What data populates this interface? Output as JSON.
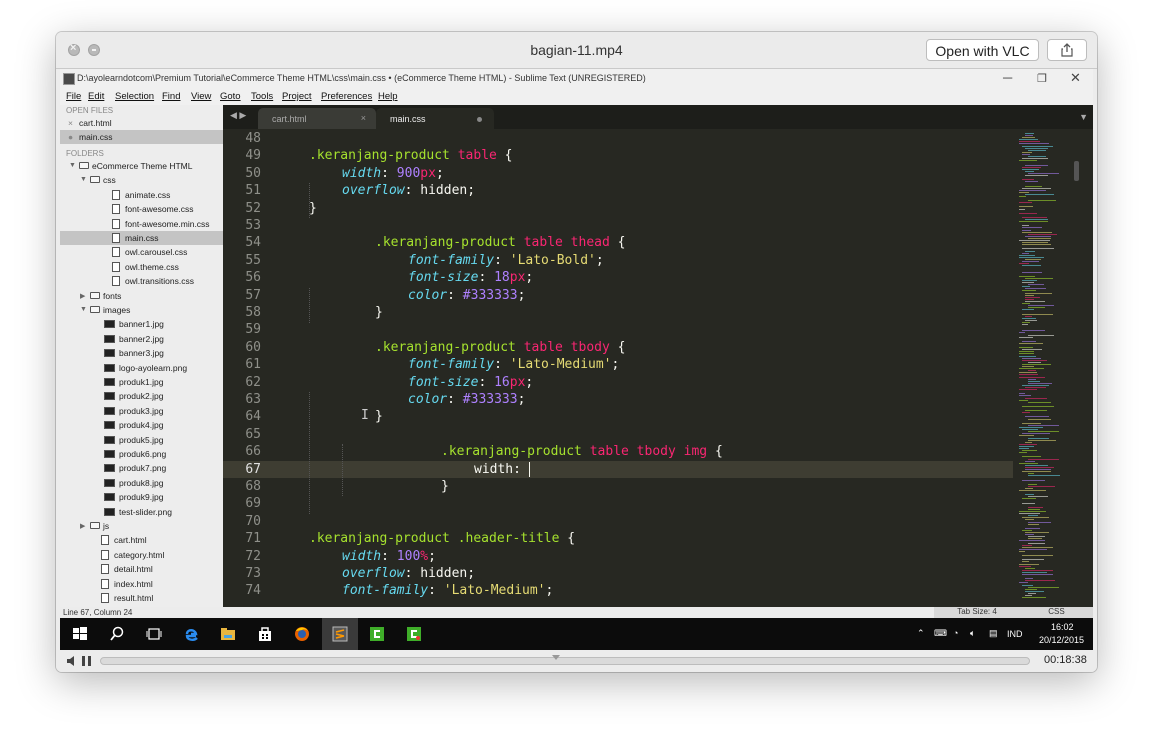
{
  "qt": {
    "title": "bagian-11.mp4",
    "open_vlc_label": "Open with VLC",
    "time": "00:18:38",
    "progress_fraction": 0.49
  },
  "sublime": {
    "title": "D:\\ayolearndotcom\\Premium Tutorial\\eCommerce Theme HTML\\css\\main.css • (eCommerce Theme HTML) - Sublime Text (UNREGISTERED)",
    "win_min": "─",
    "win_max": "❐",
    "win_close": "✕",
    "menu": [
      "File",
      "Edit",
      "Selection",
      "Find",
      "View",
      "Goto",
      "Tools",
      "Project",
      "Preferences",
      "Help"
    ],
    "sidebar": {
      "open_files_header": "OPEN FILES",
      "open_files": [
        {
          "name": "cart.html",
          "prefix": "×",
          "selected": false
        },
        {
          "name": "main.css",
          "prefix": "●",
          "selected": true
        }
      ],
      "folders_header": "FOLDERS",
      "tree": [
        {
          "name": "eCommerce Theme HTML",
          "kind": "folder-open",
          "depth": 0
        },
        {
          "name": "css",
          "kind": "folder-open",
          "depth": 1
        },
        {
          "name": "animate.css",
          "kind": "file",
          "depth": 2
        },
        {
          "name": "font-awesome.css",
          "kind": "file",
          "depth": 2
        },
        {
          "name": "font-awesome.min.css",
          "kind": "file",
          "depth": 2
        },
        {
          "name": "main.css",
          "kind": "file",
          "depth": 2,
          "selected": true
        },
        {
          "name": "owl.carousel.css",
          "kind": "file",
          "depth": 2
        },
        {
          "name": "owl.theme.css",
          "kind": "file",
          "depth": 2
        },
        {
          "name": "owl.transitions.css",
          "kind": "file",
          "depth": 2
        },
        {
          "name": "fonts",
          "kind": "folder-closed",
          "depth": 1
        },
        {
          "name": "images",
          "kind": "folder-open",
          "depth": 1
        },
        {
          "name": "banner1.jpg",
          "kind": "image",
          "depth": 2
        },
        {
          "name": "banner2.jpg",
          "kind": "image",
          "depth": 2
        },
        {
          "name": "banner3.jpg",
          "kind": "image",
          "depth": 2
        },
        {
          "name": "logo-ayolearn.png",
          "kind": "image",
          "depth": 2
        },
        {
          "name": "produk1.jpg",
          "kind": "image",
          "depth": 2
        },
        {
          "name": "produk2.jpg",
          "kind": "image",
          "depth": 2
        },
        {
          "name": "produk3.jpg",
          "kind": "image",
          "depth": 2
        },
        {
          "name": "produk4.jpg",
          "kind": "image",
          "depth": 2
        },
        {
          "name": "produk5.jpg",
          "kind": "image",
          "depth": 2
        },
        {
          "name": "produk6.png",
          "kind": "image",
          "depth": 2
        },
        {
          "name": "produk7.png",
          "kind": "image",
          "depth": 2
        },
        {
          "name": "produk8.jpg",
          "kind": "image",
          "depth": 2
        },
        {
          "name": "produk9.jpg",
          "kind": "image",
          "depth": 2
        },
        {
          "name": "test-slider.png",
          "kind": "image",
          "depth": 2
        },
        {
          "name": "js",
          "kind": "folder-closed",
          "depth": 1
        },
        {
          "name": "cart.html",
          "kind": "file",
          "depth": 1
        },
        {
          "name": "category.html",
          "kind": "file",
          "depth": 1
        },
        {
          "name": "detail.html",
          "kind": "file",
          "depth": 1
        },
        {
          "name": "index.html",
          "kind": "file",
          "depth": 1
        },
        {
          "name": "result.html",
          "kind": "file",
          "depth": 1
        }
      ]
    },
    "tabs": [
      {
        "label": "cart.html",
        "active": false,
        "close": "×"
      },
      {
        "label": "main.css",
        "active": true
      }
    ],
    "current_line": "67",
    "code_lines": [
      {
        "n": "48",
        "indent": 0,
        "tokens": []
      },
      {
        "n": "49",
        "indent": 1,
        "tokens": [
          [
            "sel",
            ".keranjang-product "
          ],
          [
            "tag",
            "table"
          ],
          [
            "w",
            " {"
          ]
        ]
      },
      {
        "n": "50",
        "indent": 2,
        "tokens": [
          [
            "prop",
            "width"
          ],
          [
            "w",
            ": "
          ],
          [
            "num",
            "900"
          ],
          [
            "unit",
            "px"
          ],
          [
            "w",
            ";"
          ]
        ]
      },
      {
        "n": "51",
        "indent": 2,
        "tokens": [
          [
            "prop",
            "overflow"
          ],
          [
            "w",
            ": hidden;"
          ]
        ]
      },
      {
        "n": "52",
        "indent": 1,
        "tokens": [
          [
            "w",
            "}"
          ]
        ]
      },
      {
        "n": "53",
        "indent": 0,
        "tokens": []
      },
      {
        "n": "54",
        "indent": 3,
        "tokens": [
          [
            "sel",
            ".keranjang-product "
          ],
          [
            "tag",
            "table thead"
          ],
          [
            "w",
            " {"
          ]
        ]
      },
      {
        "n": "55",
        "indent": 4,
        "tokens": [
          [
            "prop",
            "font-family"
          ],
          [
            "w",
            ": "
          ],
          [
            "str",
            "'Lato-Bold'"
          ],
          [
            "w",
            ";"
          ]
        ]
      },
      {
        "n": "56",
        "indent": 4,
        "tokens": [
          [
            "prop",
            "font-size"
          ],
          [
            "w",
            ": "
          ],
          [
            "num",
            "18"
          ],
          [
            "unit",
            "px"
          ],
          [
            "w",
            ";"
          ]
        ]
      },
      {
        "n": "57",
        "indent": 4,
        "tokens": [
          [
            "prop",
            "color"
          ],
          [
            "w",
            ": "
          ],
          [
            "num",
            "#333333"
          ],
          [
            "w",
            ";"
          ]
        ]
      },
      {
        "n": "58",
        "indent": 3,
        "tokens": [
          [
            "w",
            "}"
          ]
        ]
      },
      {
        "n": "59",
        "indent": 0,
        "tokens": []
      },
      {
        "n": "60",
        "indent": 3,
        "tokens": [
          [
            "sel",
            ".keranjang-product "
          ],
          [
            "tag",
            "table tbody"
          ],
          [
            "w",
            " {"
          ]
        ]
      },
      {
        "n": "61",
        "indent": 4,
        "tokens": [
          [
            "prop",
            "font-family"
          ],
          [
            "w",
            ": "
          ],
          [
            "str",
            "'Lato-Medium'"
          ],
          [
            "w",
            ";"
          ]
        ]
      },
      {
        "n": "62",
        "indent": 4,
        "tokens": [
          [
            "prop",
            "font-size"
          ],
          [
            "w",
            ": "
          ],
          [
            "num",
            "16"
          ],
          [
            "unit",
            "px"
          ],
          [
            "w",
            ";"
          ]
        ]
      },
      {
        "n": "63",
        "indent": 4,
        "tokens": [
          [
            "prop",
            "color"
          ],
          [
            "w",
            ": "
          ],
          [
            "num",
            "#333333"
          ],
          [
            "w",
            ";"
          ]
        ]
      },
      {
        "n": "64",
        "indent": 3,
        "tokens": [
          [
            "w",
            "}"
          ]
        ]
      },
      {
        "n": "65",
        "indent": 0,
        "tokens": []
      },
      {
        "n": "66",
        "indent": 5,
        "tokens": [
          [
            "sel",
            ".keranjang-product "
          ],
          [
            "tag",
            "table tbody img"
          ],
          [
            "w",
            " {"
          ]
        ]
      },
      {
        "n": "67",
        "indent": 6,
        "tokens": [
          [
            "w",
            "width: "
          ]
        ]
      },
      {
        "n": "68",
        "indent": 5,
        "tokens": [
          [
            "w",
            "}"
          ]
        ]
      },
      {
        "n": "69",
        "indent": 0,
        "tokens": []
      },
      {
        "n": "70",
        "indent": 0,
        "tokens": []
      },
      {
        "n": "71",
        "indent": 1,
        "tokens": [
          [
            "sel",
            ".keranjang-product .header-title"
          ],
          [
            "w",
            " {"
          ]
        ]
      },
      {
        "n": "72",
        "indent": 2,
        "tokens": [
          [
            "prop",
            "width"
          ],
          [
            "w",
            ": "
          ],
          [
            "num",
            "100"
          ],
          [
            "unit",
            "%"
          ],
          [
            "w",
            ";"
          ]
        ]
      },
      {
        "n": "73",
        "indent": 2,
        "tokens": [
          [
            "prop",
            "overflow"
          ],
          [
            "w",
            ": hidden;"
          ]
        ]
      },
      {
        "n": "74",
        "indent": 2,
        "tokens": [
          [
            "prop",
            "font-family"
          ],
          [
            "w",
            ": "
          ],
          [
            "str",
            "'Lato-Medium'"
          ],
          [
            "w",
            ";"
          ]
        ]
      }
    ],
    "status": {
      "position": "Line 67, Column 24",
      "tab_size": "Tab Size: 4",
      "syntax": "CSS"
    }
  },
  "taskbar": {
    "lang": "IND",
    "time": "16:02",
    "date": "20/12/2015"
  },
  "colors": {
    "editor_bg": "#272822",
    "selector": "#a6e22e",
    "tag": "#f92672",
    "property": "#66d9ef",
    "number": "#ae81ff",
    "string": "#e6db74"
  }
}
